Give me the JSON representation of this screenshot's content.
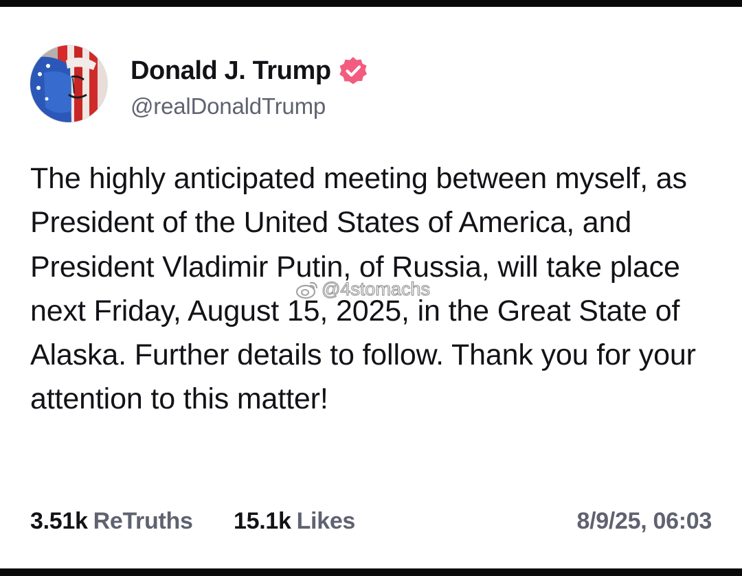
{
  "post": {
    "author": {
      "display_name": "Donald J. Trump",
      "handle": "@realDonaldTrump",
      "verified_icon": "verified-badge-icon",
      "verified_color": "#f25c7e"
    },
    "body": "The highly anticipated meeting between myself, as President of the United States of America, and President Vladimir Putin, of Russia, will take place next Friday, August 15, 2025, in the Great State of Alaska. Further details to follow. Thank you for your attention to this matter!",
    "stats": {
      "retruths_count": "3.51k",
      "retruths_label": "ReTruths",
      "likes_count": "15.1k",
      "likes_label": "Likes"
    },
    "timestamp": "8/9/25, 06:03"
  },
  "watermark": {
    "icon": "weibo-icon",
    "text": "@4stomachs"
  }
}
